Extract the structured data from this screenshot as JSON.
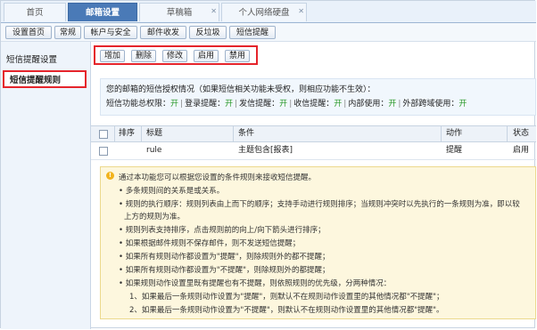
{
  "tabs": [
    {
      "label": "首页"
    },
    {
      "label": "邮箱设置"
    },
    {
      "label": "草稿箱"
    },
    {
      "label": "个人网络硬盘"
    }
  ],
  "toolbar": [
    "设置首页",
    "常规",
    "帐户与安全",
    "邮件收发",
    "反垃圾",
    "短信提醒"
  ],
  "sidebar": {
    "items": [
      {
        "label": "短信提醒设置"
      },
      {
        "label": "短信提醒规则"
      }
    ]
  },
  "actions": [
    "增加",
    "删除",
    "修改",
    "启用",
    "禁用"
  ],
  "auth": {
    "line1": "您的邮箱的短信授权情况（如果短信相关功能未受权，则相应功能不生效）：",
    "items": [
      {
        "label": "短信功能总权限：",
        "value": "开"
      },
      {
        "label": "登录提醒：",
        "value": "开"
      },
      {
        "label": "发信提醒：",
        "value": "开"
      },
      {
        "label": "收信提醒：",
        "value": "开"
      },
      {
        "label": "内部使用：",
        "value": "开"
      },
      {
        "label": "外部跨域使用：",
        "value": "开"
      }
    ]
  },
  "table": {
    "headers": {
      "order": "排序",
      "title": "标题",
      "condition": "条件",
      "action": "动作",
      "status": "状态"
    },
    "rows": [
      {
        "order": "",
        "title": "rule",
        "condition": "主题包含[报表]",
        "action": "提醒",
        "status": "启用"
      }
    ]
  },
  "info": {
    "lines": [
      "通过本功能您可以根据您设置的条件规则来接收短信提醒。",
      "• 多条规则间的关系是或关系。",
      "• 规则的执行顺序：规则列表由上而下的顺序；支持手动进行规则排序；当规则冲突时以先执行的一条规则为准，即以较",
      "上方的规则为准。",
      "• 规则列表支持排序，点击规则前的向上/向下箭头进行排序；",
      "• 如果根据邮件规则不保存邮件，则不发送短信提醒；",
      "• 如果所有规则动作都设置为\"提醒\"，则除规则外的都不提醒；",
      "• 如果所有规则动作都设置为\"不提醒\"，则除规则外的都提醒；",
      "• 如果规则动作设置里既有提醒也有不提醒，则依照规则的优先级，分两种情况：",
      "1、如果最后一条规则动作设置为\"提醒\"，则默认不在规则动作设置里的其他情况都\"不提醒\"；",
      "2、如果最后一条规则动作设置为\"不提醒\"，则默认不在规则动作设置里的其他情况都\"提醒\"。"
    ]
  },
  "colors": {
    "accent": "#4a7ab7",
    "highlight_border": "#e5242b",
    "status_on": "#2b9a2b",
    "info_bg": "#fdf7de"
  }
}
